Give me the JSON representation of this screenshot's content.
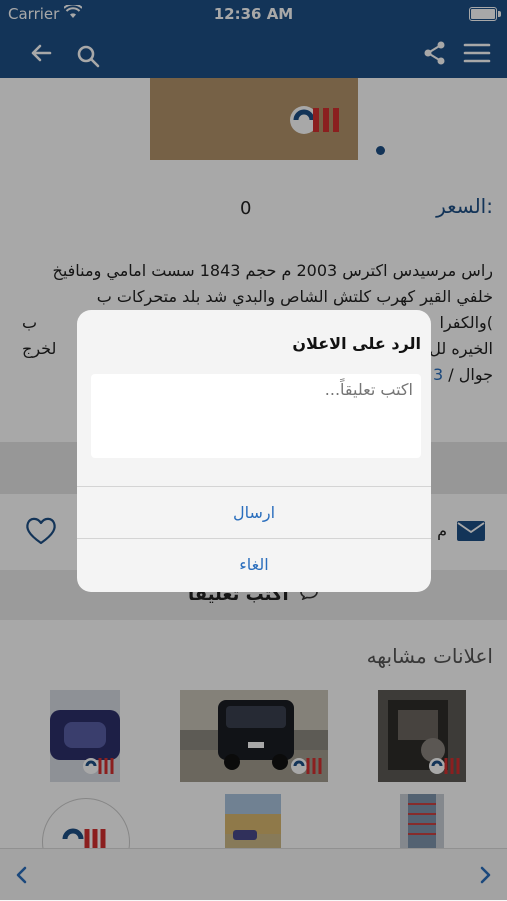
{
  "status": {
    "carrier": "Carrier",
    "time": "12:36 AM"
  },
  "listing": {
    "price_label": "السعر:",
    "price_value": "0",
    "description": "راس مرسيدس اكترس 2003 م حجم 1843 سست امامي ومنافيخ خلفي القير كهرب كلتش الشاص والبدي شد بلد متحركات ب",
    "description_line4": ")والكفرا",
    "description_line4_end": "ب",
    "description_line5": "الخيره لل",
    "description_line5_end": "لخرج",
    "phone_prefix": "جوال /",
    "phone_link": "3"
  },
  "actions": {
    "mail_label": "م"
  },
  "comment_button": {
    "label": "اكتب تعليقا"
  },
  "similar": {
    "title": "اعلانات مشابهه"
  },
  "dialog": {
    "title": "الرد على الاعلان",
    "placeholder": "اكتب تعليقاً...",
    "send": "ارسال",
    "cancel": "الغاء"
  },
  "colors": {
    "brand": "#1e4f86",
    "link": "#2a6ebd"
  },
  "icons": {
    "nav": [
      "back-arrow-icon",
      "search-icon",
      "share-icon",
      "menu-icon"
    ],
    "actions": [
      "heart-icon",
      "mail-icon",
      "comment-bubble-icon"
    ],
    "bottom": [
      "chevron-left-icon",
      "chevron-right-icon"
    ]
  }
}
